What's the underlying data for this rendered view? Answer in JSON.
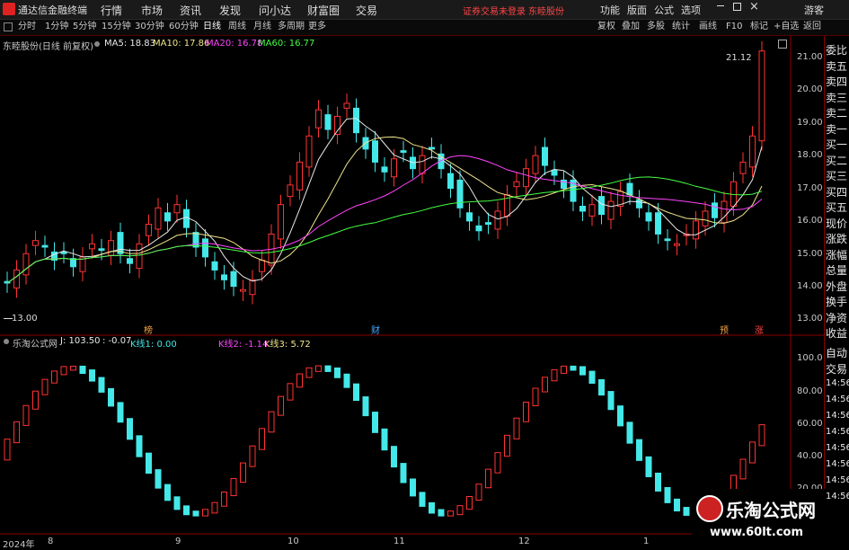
{
  "app": {
    "title": "通达信金融终端"
  },
  "menu": [
    "行情",
    "市场",
    "资讯",
    "发现",
    "问小达",
    "财富圈",
    "交易"
  ],
  "status": {
    "login_warning": "证券交易未登录",
    "stock_name": "东睦股份"
  },
  "right_menu": [
    "功能",
    "版面",
    "公式",
    "选项",
    "游客"
  ],
  "toolbar": {
    "periods": [
      "分时",
      "1分钟",
      "5分钟",
      "15分钟",
      "30分钟",
      "60分钟",
      "日线",
      "周线",
      "月线",
      "多周期",
      "更多"
    ],
    "active": "日线",
    "right": [
      "复权",
      "叠加",
      "多股",
      "统计",
      "画线",
      "F10",
      "标记",
      "+自选",
      "返回"
    ]
  },
  "main_legend": {
    "title": "东睦股份(日线 前复权)",
    "ma5": "MA5: 18.83",
    "ma10": "MA10: 17.86",
    "ma20": "MA20: 16.78",
    "ma60": "MA60: 16.77"
  },
  "colors": {
    "ma5": "#e8e8e8",
    "ma10": "#f0e68c",
    "ma20": "#ff44ff",
    "ma60": "#44ff44",
    "up": "#ff3333",
    "down": "#44e8e8"
  },
  "price_axis": [
    "21.00",
    "20.00",
    "19.00",
    "18.00",
    "17.00",
    "16.00",
    "15.00",
    "14.00",
    "13.00"
  ],
  "annotations": {
    "high": "21.12",
    "low": "13.00",
    "markers": [
      "榜",
      "财",
      "预",
      "涨"
    ]
  },
  "sub_legend": {
    "title": "乐淘公式网",
    "j": "J: 103.50",
    "jchg": ": -0.07",
    "k1": "K线1: 0.00",
    "k2": "K线2: -1.14",
    "k3": "K线3: 5.72"
  },
  "sub_axis": [
    "100.0",
    "80.00",
    "60.00",
    "40.00",
    "20.00"
  ],
  "date_axis": [
    "2024年",
    "8",
    "9",
    "10",
    "11",
    "12",
    "1"
  ],
  "right_panel": {
    "items": [
      "委比",
      "卖五",
      "卖四",
      "卖三",
      "卖二",
      "卖一",
      "买一",
      "买二",
      "买三",
      "买四",
      "买五",
      "现价",
      "涨跌",
      "涨幅",
      "总量",
      "外盘",
      "换手",
      "净资",
      "收益"
    ],
    "bottom": [
      "自动",
      "交易",
      "14:56",
      "14:56",
      "14:56",
      "14:56",
      "14:56",
      "14:56",
      "14:56",
      "14:56"
    ]
  },
  "watermark": {
    "name": "乐淘公式网",
    "url": "www.60lt.com"
  }
}
